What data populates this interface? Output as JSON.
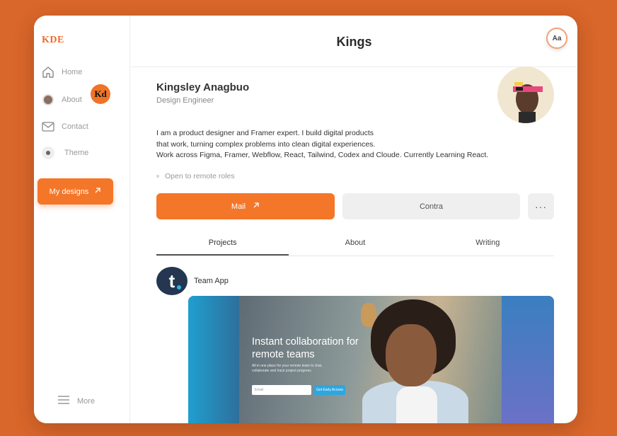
{
  "brand": {
    "logo": "KDE",
    "badge": "Kd"
  },
  "sidebar": {
    "items": [
      {
        "label": "Home",
        "icon": "home-icon"
      },
      {
        "label": "About",
        "icon": "avatar"
      },
      {
        "label": "Contact",
        "icon": "mail-icon"
      },
      {
        "label": "Theme",
        "icon": "theme-icon"
      }
    ],
    "designs_button": "My designs",
    "more": "More"
  },
  "header": {
    "title": "Kings",
    "font_button": "Aa"
  },
  "profile": {
    "name": "Kingsley Anagbuo",
    "role": "Design Engineer",
    "bio_lines": [
      "I am a product designer and Framer expert. I build digital products",
      "that work, turning complex problems into clean digital experiences.",
      "Work across Figma, Framer, Webflow, React, Tailwind, Codex and Cloude. Currently Learning React."
    ],
    "status": "Open to remote roles"
  },
  "actions": {
    "mail": "Mail",
    "contra": "Contra",
    "more": "···"
  },
  "tabs": [
    "Projects",
    "About",
    "Writing"
  ],
  "project": {
    "logo_letter": "t",
    "name": "Team App",
    "hero_title": "Instant collaboration for remote teams",
    "hero_sub": "All in one place for your remote team to chat, collaborate and track project progress.",
    "input_placeholder": "Email",
    "cta": "Get Early Access"
  },
  "colors": {
    "accent": "#f47628",
    "background": "#d9662a",
    "navy": "#243650"
  }
}
